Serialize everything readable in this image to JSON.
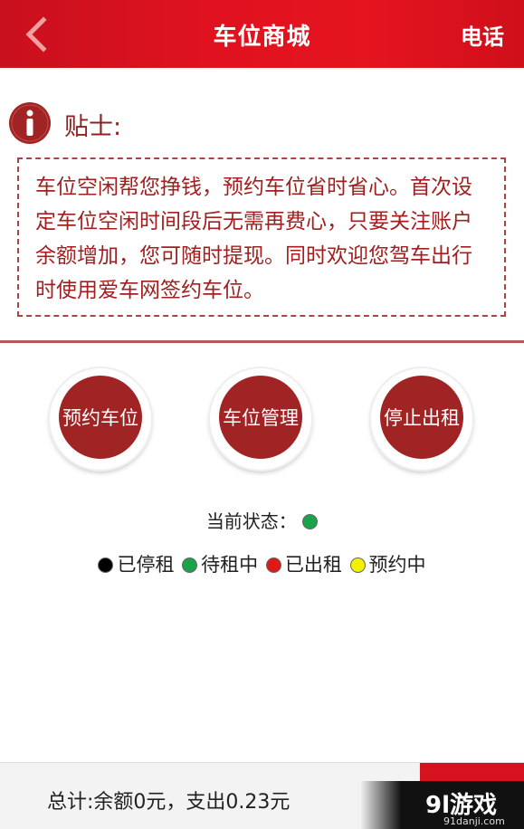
{
  "header": {
    "title": "车位商城",
    "phone_label": "电话"
  },
  "tip": {
    "label": "贴士:",
    "text": "车位空闲帮您挣钱，预约车位省时省心。首次设定车位空闲时间段后无需再费心，只要关注账户余额增加，您可随时提现。同时欢迎您驾车出行时使用爱车网签约车位。"
  },
  "actions": [
    {
      "label": "预约车位"
    },
    {
      "label": "车位管理"
    },
    {
      "label": "停止出租"
    }
  ],
  "status": {
    "label": "当前状态：",
    "current_color": "#1aa34a"
  },
  "legend": [
    {
      "label": "已停租",
      "color": "#000000"
    },
    {
      "label": "待租中",
      "color": "#1aa34a"
    },
    {
      "label": "已出租",
      "color": "#e01818"
    },
    {
      "label": "预约中",
      "color": "#f2f200"
    }
  ],
  "footer": {
    "total_text": "总计:余额0元，支出0.23元"
  },
  "watermark": {
    "logo": "9l游戏",
    "url": "91danji.com"
  },
  "colors": {
    "header_red": "#e0121f",
    "accent_dark_red": "#a12424"
  }
}
